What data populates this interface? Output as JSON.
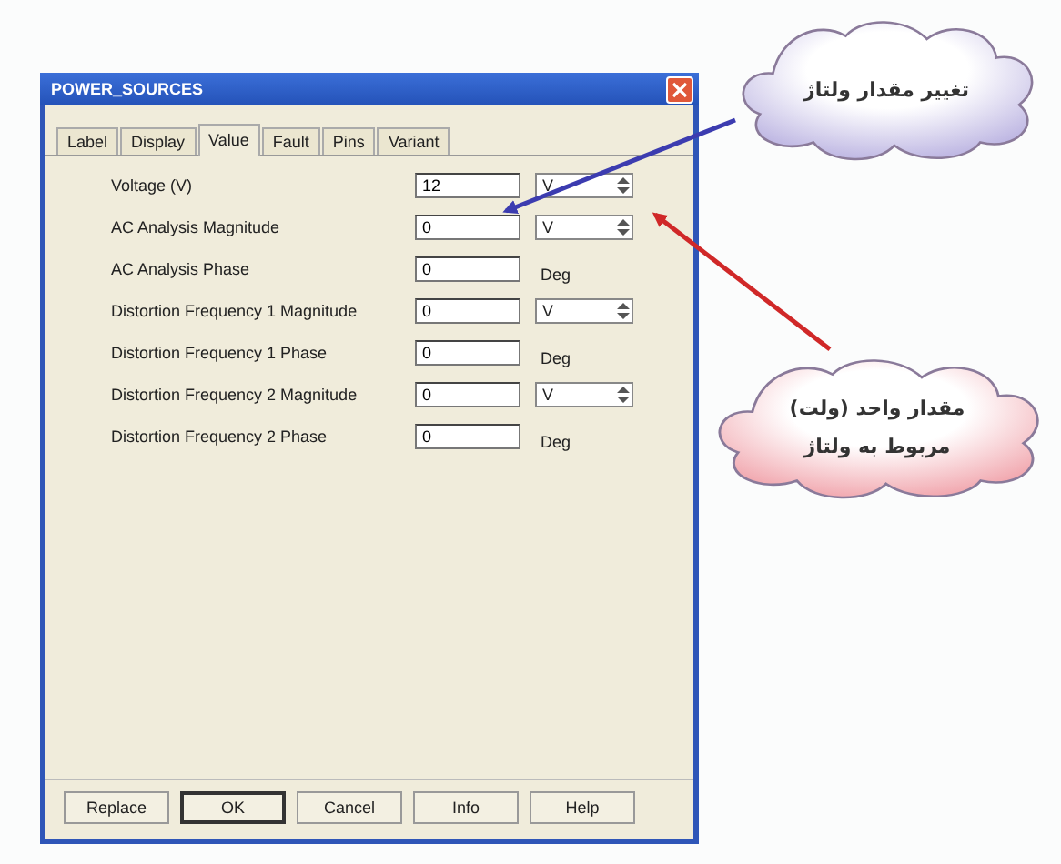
{
  "window": {
    "title": "POWER_SOURCES"
  },
  "tabs": [
    {
      "label": "Label",
      "selected": false
    },
    {
      "label": "Display",
      "selected": false
    },
    {
      "label": "Value",
      "selected": true
    },
    {
      "label": "Fault",
      "selected": false
    },
    {
      "label": "Pins",
      "selected": false
    },
    {
      "label": "Variant",
      "selected": false
    }
  ],
  "parameters": [
    {
      "label": "Voltage (V)",
      "value": "12",
      "unit": "V",
      "kind": "spin"
    },
    {
      "label": "AC Analysis Magnitude",
      "value": "0",
      "unit": "V",
      "kind": "spin"
    },
    {
      "label": "AC Analysis Phase",
      "value": "0",
      "unit": "Deg",
      "kind": "plain"
    },
    {
      "label": "Distortion Frequency 1 Magnitude",
      "value": "0",
      "unit": "V",
      "kind": "spin"
    },
    {
      "label": "Distortion Frequency 1 Phase",
      "value": "0",
      "unit": "Deg",
      "kind": "plain"
    },
    {
      "label": "Distortion Frequency 2 Magnitude",
      "value": "0",
      "unit": "V",
      "kind": "spin"
    },
    {
      "label": "Distortion Frequency 2 Phase",
      "value": "0",
      "unit": "Deg",
      "kind": "plain"
    }
  ],
  "buttons": [
    {
      "label": "Replace",
      "default": false
    },
    {
      "label": "OK",
      "default": true
    },
    {
      "label": "Cancel",
      "default": false
    },
    {
      "label": "Info",
      "default": false
    },
    {
      "label": "Help",
      "default": false
    }
  ],
  "callouts": [
    {
      "lines": [
        "تغییر مقدار ولتاژ"
      ],
      "color": "#b8b0e0"
    },
    {
      "lines": [
        "مقدار واحد (ولت)",
        "مربوط به ولتاژ"
      ],
      "color": "#f0a0a8"
    }
  ]
}
